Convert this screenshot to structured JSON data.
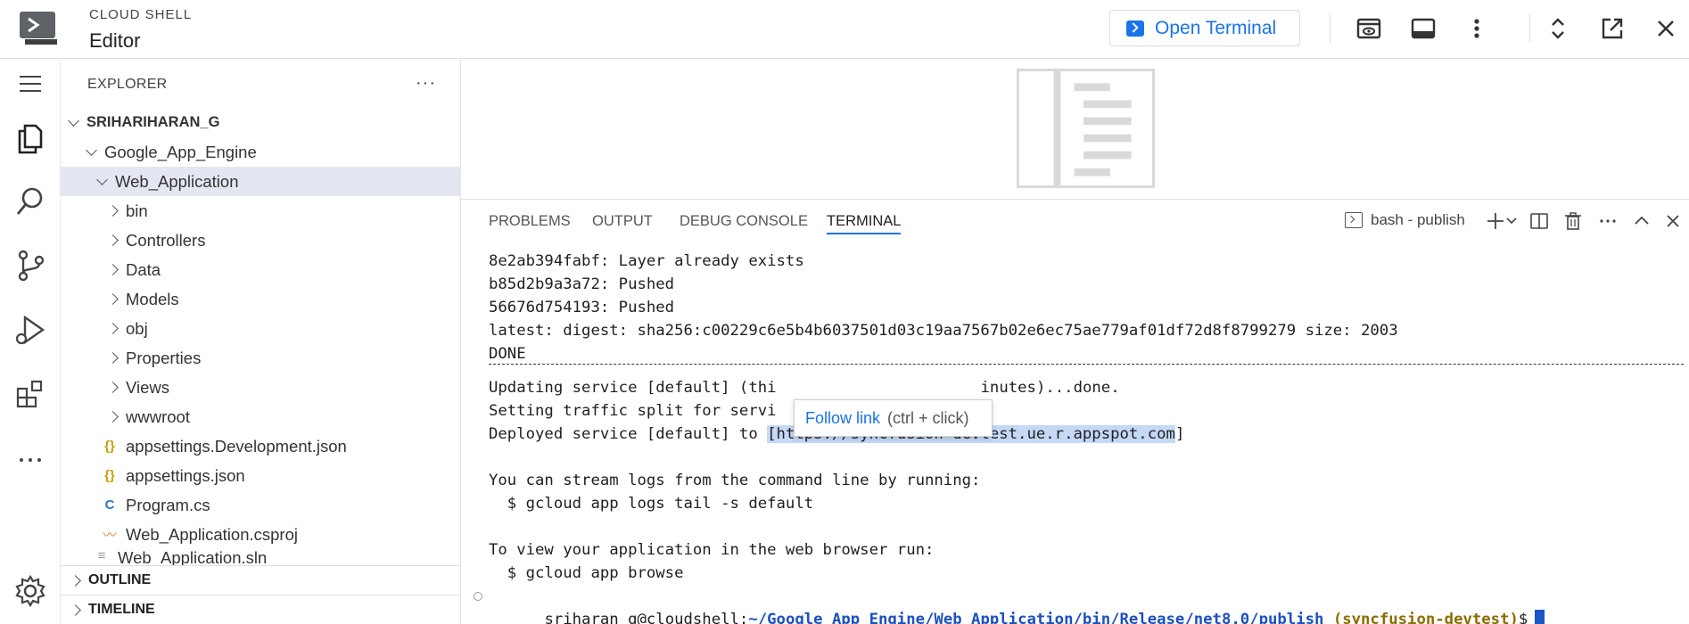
{
  "header": {
    "brand_small": "CLOUD SHELL",
    "brand_main": "Editor",
    "open_terminal_label": "Open Terminal"
  },
  "explorer": {
    "title": "EXPLORER",
    "more": "···",
    "root": "SRIHARIHARAN_G",
    "items": [
      {
        "label": "Google_App_Engine"
      },
      {
        "label": "Web_Application"
      },
      {
        "label": "bin"
      },
      {
        "label": "Controllers"
      },
      {
        "label": "Data"
      },
      {
        "label": "Models"
      },
      {
        "label": "obj"
      },
      {
        "label": "Properties"
      },
      {
        "label": "Views"
      },
      {
        "label": "wwwroot"
      },
      {
        "label": "appsettings.Development.json"
      },
      {
        "label": "appsettings.json"
      },
      {
        "label": "Program.cs"
      },
      {
        "label": "Web_Application.csproj"
      },
      {
        "label": "Web_Application.sln"
      }
    ],
    "sections": [
      "OUTLINE",
      "TIMELINE"
    ]
  },
  "panel": {
    "tabs": [
      "PROBLEMS",
      "OUTPUT",
      "DEBUG CONSOLE",
      "TERMINAL"
    ],
    "active_tab": "TERMINAL",
    "terminal_name": "bash - publish"
  },
  "terminal": {
    "lines": [
      "8e2ab394fabf: Layer already exists",
      "b85d2b9a3a72: Pushed",
      "56676d754193: Pushed",
      "latest: digest: sha256:c00229c6e5b4b6037501d03c19aa7567b02e6ec75ae779af01df72d8f8799279 size: 2003",
      "DONE"
    ],
    "updating": "Updating service [default] (thi",
    "updating_end": "inutes)...done.",
    "setting": "Setting traffic split for servi",
    "deployed_prefix": "Deployed service [default] to ",
    "deployed_url": "[https://syncfusion-devtest.ue.r.appspot.com",
    "deployed_suffix": "]",
    "stream": "You can stream logs from the command line by running:",
    "stream_cmd": "  $ gcloud app logs tail -s default",
    "view": "To view your application in the web browser run:",
    "view_cmd": "  $ gcloud app browse",
    "prompt_user": "sriharan_g@cloudshell:",
    "prompt_path": "~/Google_App_Engine/Web_Application/bin/Release/net8.0/publish",
    "prompt_project": "(syncfusion-devtest)",
    "prompt_symbol": "$"
  },
  "tooltip": {
    "label": "Follow link",
    "hint": "(ctrl + click)"
  },
  "colors": {
    "accent": "#1a73e8",
    "selection": "#e4e6f1",
    "link_highlight": "#c5d8f6"
  }
}
